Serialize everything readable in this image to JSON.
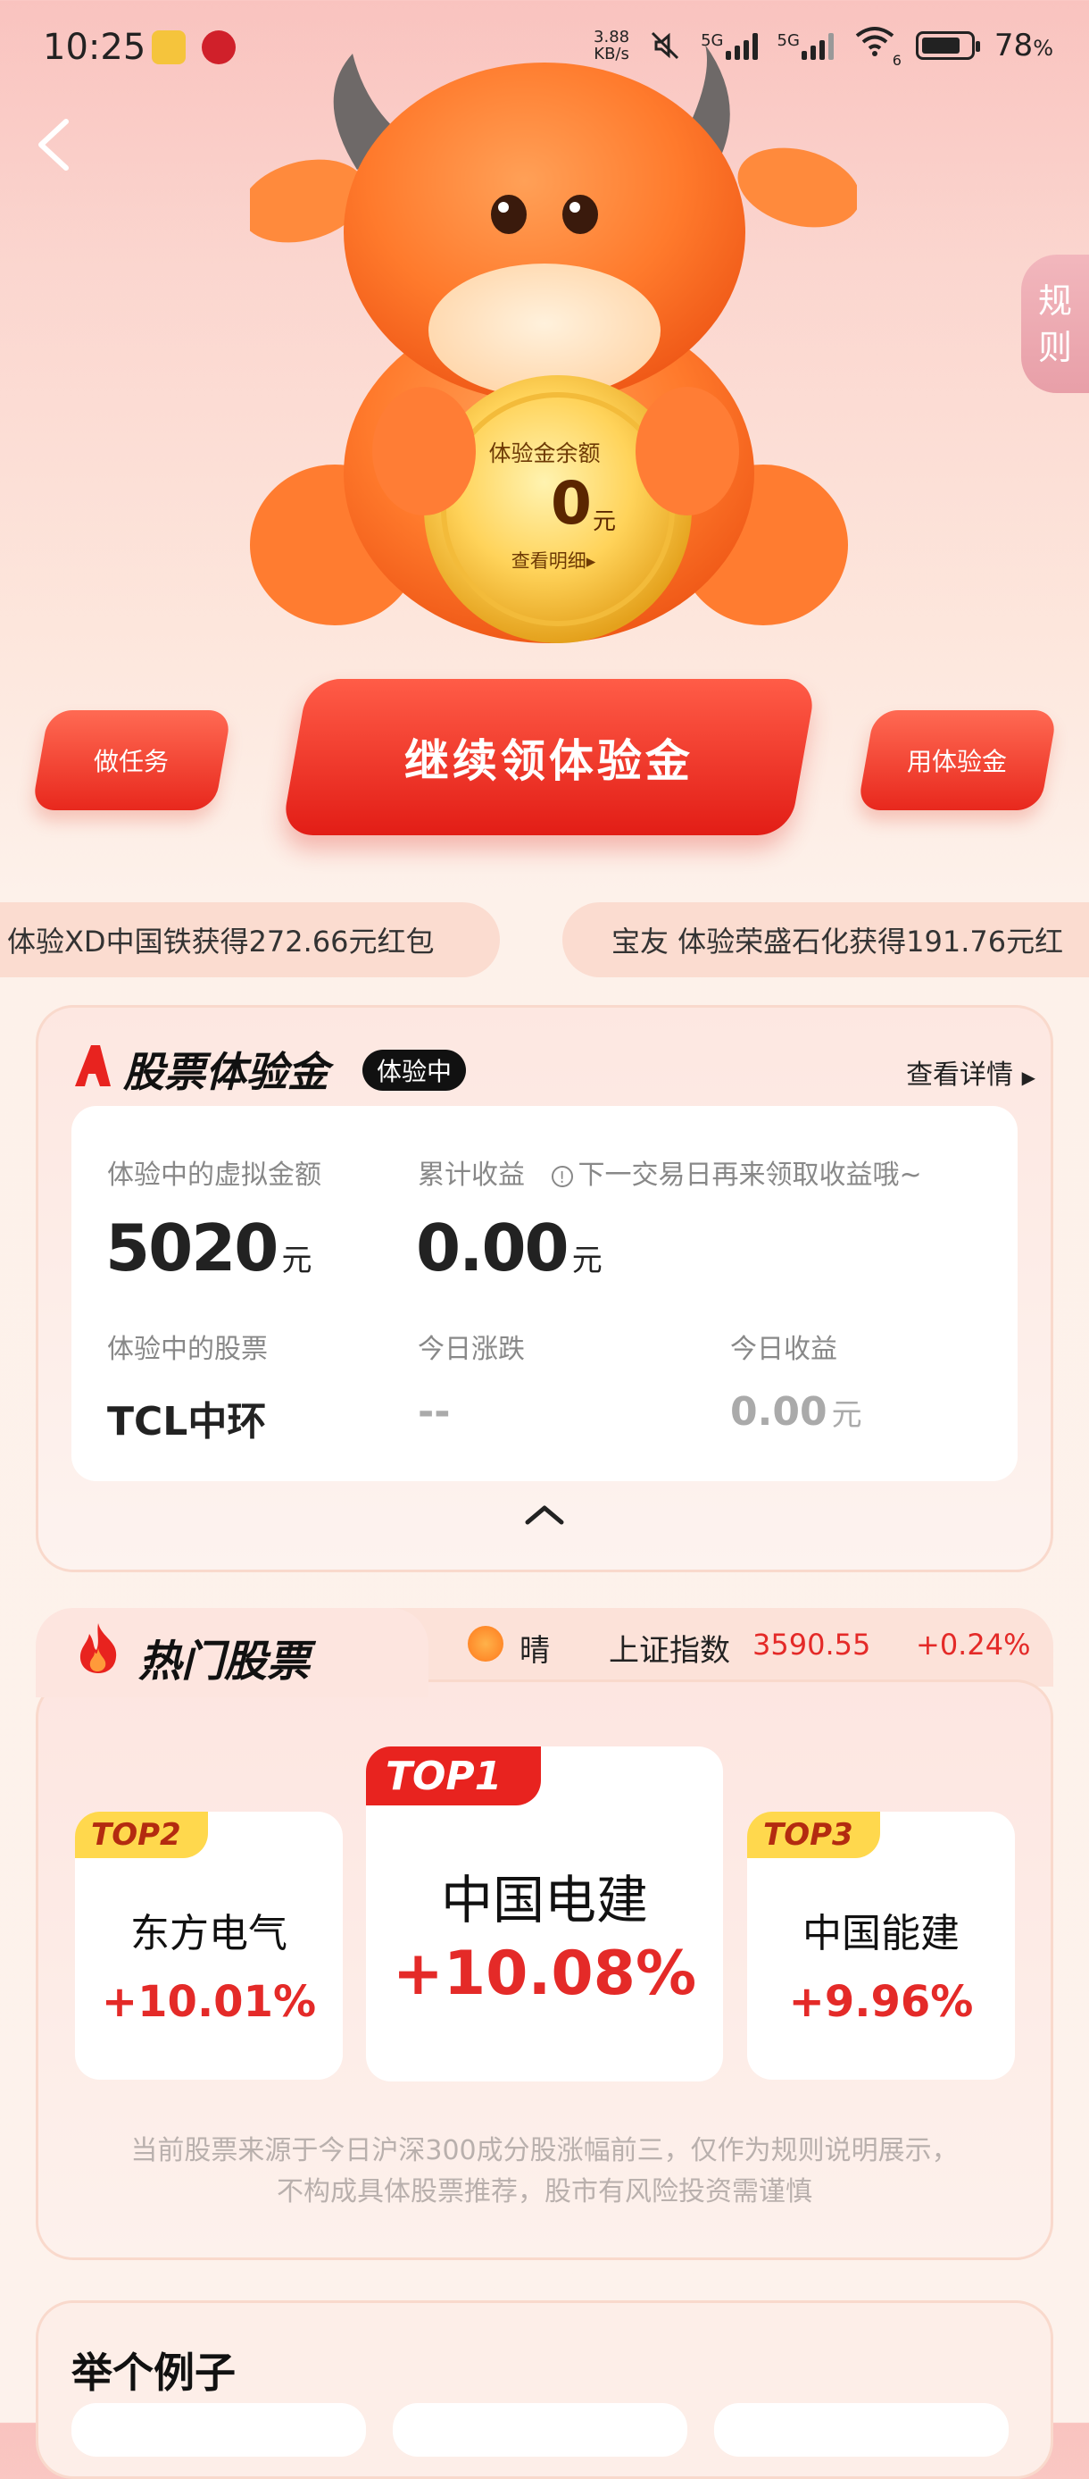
{
  "status_bar": {
    "time": "10:25",
    "net_speed_top": "3.88",
    "net_speed_unit": "KB/s",
    "sim1": "5G",
    "sim2": "5G",
    "wifi_label": "6",
    "battery": "78",
    "battery_unit": "%",
    "icons": [
      "notes-icon",
      "app-notification-icon",
      "mute-icon",
      "signal-icon",
      "wifi-icon",
      "battery-icon"
    ]
  },
  "rules_tab": {
    "line1": "规",
    "line2": "则"
  },
  "coin": {
    "label": "体验金余额",
    "value": "0",
    "unit": "元",
    "detail": "查看明细▸"
  },
  "actions": {
    "task": "做任务",
    "main": "继续领体验金",
    "use": "用体验金"
  },
  "ticker": [
    "体验XD中国铁获得272.66元红包",
    "宝友 体验荣盛石化获得191.76元红"
  ],
  "experience_card": {
    "title": "股票体验金",
    "status": "体验中",
    "detail_link": "查看详情",
    "amount_label": "体验中的虚拟金额",
    "amount_value": "5020",
    "amount_unit": "元",
    "income_label": "累计收益",
    "income_note": "下一交易日再来领取收益哦~",
    "income_value": "0.00",
    "income_unit": "元",
    "stock_label": "体验中的股票",
    "stock_value": "TCL中环",
    "today_change_label": "今日涨跌",
    "today_change_value": "--",
    "today_income_label": "今日收益",
    "today_income_value": "0.00",
    "today_income_unit": "元"
  },
  "hot_stocks": {
    "title": "热门股票",
    "weather": "晴",
    "index_name": "上证指数",
    "index_value": "3590.55",
    "index_change": "+0.24%",
    "top1": {
      "badge": "TOP1",
      "name": "中国电建",
      "change": "+10.08%"
    },
    "top2": {
      "badge": "TOP2",
      "name": "东方电气",
      "change": "+10.01%"
    },
    "top3": {
      "badge": "TOP3",
      "name": "中国能建",
      "change": "+9.96%"
    },
    "disclaimer": "当前股票来源于今日沪深300成分股涨幅前三，仅作为规则说明展示，不构成具体股票推荐，股市有风险投资需谨慎"
  },
  "example": {
    "title": "举个例子"
  },
  "colors": {
    "accent_red": "#e42a28",
    "button_red": "#e8281d",
    "gold": "#ffd84d"
  }
}
